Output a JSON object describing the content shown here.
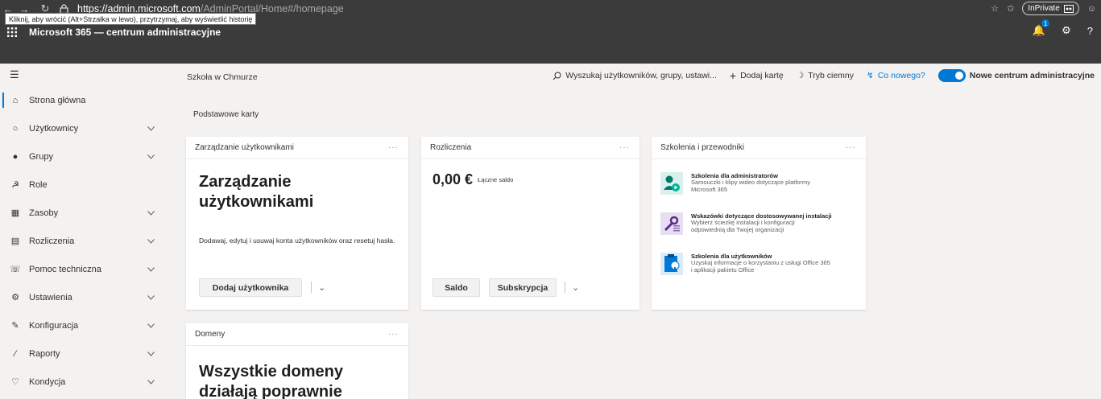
{
  "browser": {
    "url_scheme": "https://",
    "url_host": "admin.microsoft.com",
    "url_path": "/AdminPortal/Home#/homepage",
    "inprivate_label": "InPrivate",
    "back_tooltip": "Kliknij, aby wrócić (Alt+Strzałka w lewo), przytrzymaj, aby wyświetlić historię"
  },
  "header": {
    "app_title": "Microsoft 365 — centrum administracyjne",
    "notification_count": "1",
    "help_label": "?"
  },
  "sidebar": {
    "items": [
      {
        "label": "Strona główna",
        "icon": "home-icon",
        "expandable": false,
        "active": true
      },
      {
        "label": "Użytkownicy",
        "icon": "user-icon",
        "expandable": true
      },
      {
        "label": "Grupy",
        "icon": "groups-icon",
        "expandable": true
      },
      {
        "label": "Role",
        "icon": "roles-icon",
        "expandable": false
      },
      {
        "label": "Zasoby",
        "icon": "resources-icon",
        "expandable": true
      },
      {
        "label": "Rozliczenia",
        "icon": "billing-icon",
        "expandable": true
      },
      {
        "label": "Pomoc techniczna",
        "icon": "support-icon",
        "expandable": true
      },
      {
        "label": "Ustawienia",
        "icon": "settings-icon",
        "expandable": true
      },
      {
        "label": "Konfiguracja",
        "icon": "setup-icon",
        "expandable": true
      },
      {
        "label": "Raporty",
        "icon": "reports-icon",
        "expandable": true
      },
      {
        "label": "Kondycja",
        "icon": "health-icon",
        "expandable": true
      }
    ]
  },
  "commandbar": {
    "tenant": "Szkoła w Chmurze",
    "search_placeholder": "Wyszukaj użytkowników, grupy, ustawi...",
    "add_card": "Dodaj kartę",
    "dark_mode": "Tryb ciemny",
    "whats_new": "Co nowego?",
    "new_admin_center": "Nowe centrum administracyjne",
    "accent": "#0078d4"
  },
  "main": {
    "section_title": "Podstawowe karty",
    "cards": {
      "users": {
        "header": "Zarządzanie użytkownikami",
        "title_line1": "Zarządzanie",
        "title_line2": "użytkownikami",
        "description": "Dodawaj, edytuj i usuwaj konta użytkowników oraz resetuj hasła.",
        "primary_button": "Dodaj użytkownika"
      },
      "billing": {
        "header": "Rozliczenia",
        "amount": "0,00 €",
        "amount_label": "Łączne saldo",
        "button_balance": "Saldo",
        "button_subscription": "Subskrypcja"
      },
      "training": {
        "header": "Szkolenia i przewodniki",
        "items": [
          {
            "title": "Szkolenia dla administratorów",
            "desc": "Samouczki i klipy wideo dotyczące platformy Microsoft 365"
          },
          {
            "title": "Wskazówki dotyczące dostosowywanej instalacji",
            "desc": "Wybierz ścieżkę instalacji i konfiguracji odpowiednią dla Twojej organizacji"
          },
          {
            "title": "Szkolenia dla użytkowników",
            "desc": "Uzyskaj informacje o korzystaniu z usługi Office 365 i aplikacji pakietu Office"
          }
        ]
      },
      "domains": {
        "header": "Domeny",
        "title_line1": "Wszystkie domeny",
        "title_line2": "działają poprawnie"
      }
    }
  }
}
